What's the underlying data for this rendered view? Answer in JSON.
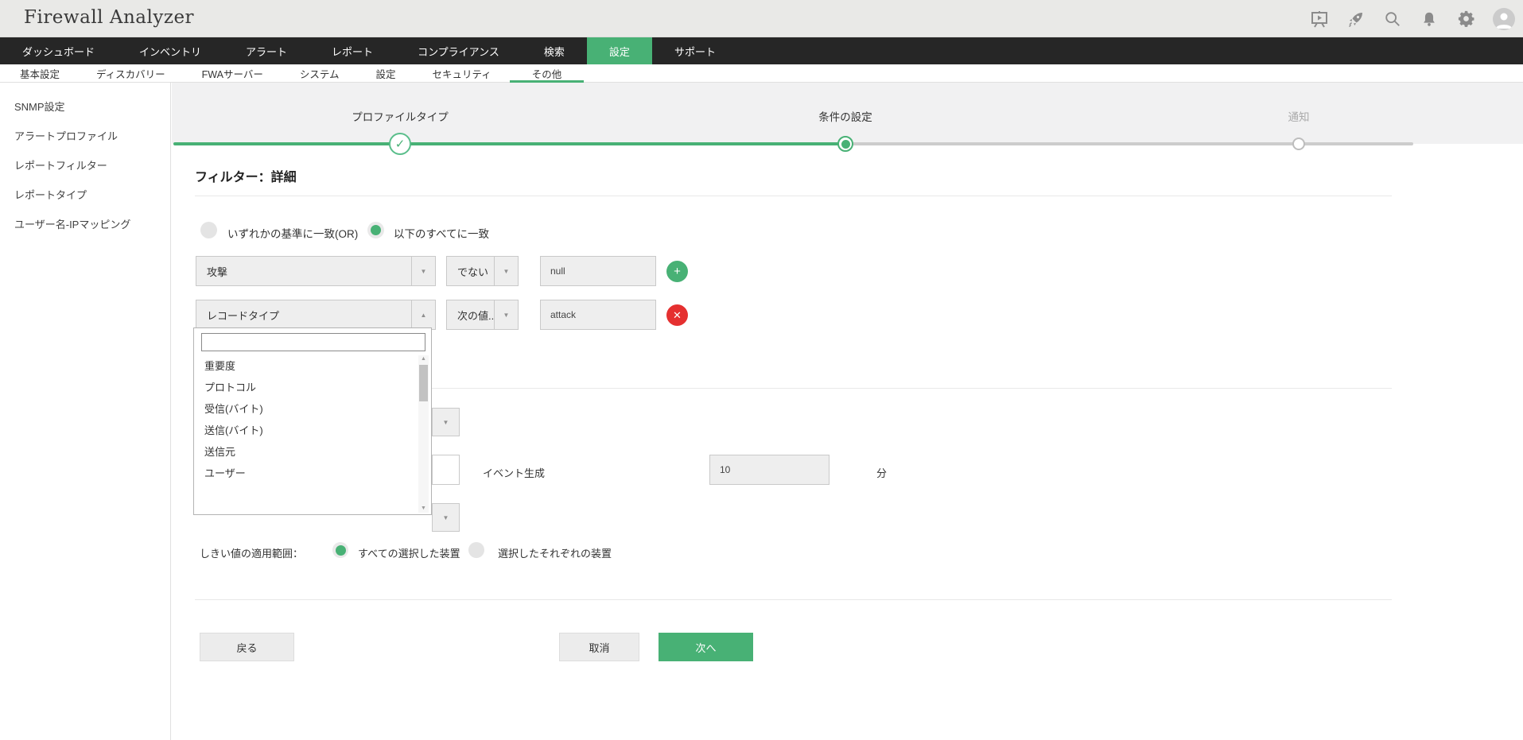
{
  "colors": {
    "accent": "#48b175",
    "red": "#e53030",
    "nav_bg": "#262626"
  },
  "header": {
    "title": "Firewall Analyzer",
    "icons": [
      "presentation-icon",
      "rocket-icon",
      "search-icon",
      "bell-icon",
      "gear-icon",
      "avatar"
    ]
  },
  "nav": {
    "items": [
      {
        "label": "ダッシュボード",
        "active": false
      },
      {
        "label": "インベントリ",
        "active": false
      },
      {
        "label": "アラート",
        "active": false
      },
      {
        "label": "レポート",
        "active": false
      },
      {
        "label": "コンプライアンス",
        "active": false
      },
      {
        "label": "検索",
        "active": false
      },
      {
        "label": "設定",
        "active": true
      },
      {
        "label": "サポート",
        "active": false
      }
    ]
  },
  "subnav": {
    "items": [
      {
        "label": "基本設定",
        "active": false
      },
      {
        "label": "ディスカバリー",
        "active": false
      },
      {
        "label": "FWAサーバー",
        "active": false
      },
      {
        "label": "システム",
        "active": false
      },
      {
        "label": "設定",
        "active": false
      },
      {
        "label": "セキュリティ",
        "active": false
      },
      {
        "label": "その他",
        "active": true
      }
    ]
  },
  "sidebar": {
    "items": [
      {
        "label": "SNMP設定"
      },
      {
        "label": "アラートプロファイル"
      },
      {
        "label": "レポートフィルター"
      },
      {
        "label": "レポートタイプ"
      },
      {
        "label": "ユーザー名-IPマッピング"
      }
    ]
  },
  "stepper": {
    "steps": [
      {
        "label": "プロファイルタイプ",
        "state": "done",
        "check": "✓"
      },
      {
        "label": "条件の設定",
        "state": "current"
      },
      {
        "label": "通知",
        "state": "upcoming"
      }
    ]
  },
  "main": {
    "heading": "フィルター：詳細",
    "match_radios": {
      "any_label": "いずれかの基準に一致(OR)",
      "all_label": "以下のすべてに一致",
      "selected": "all"
    },
    "filter_rows": [
      {
        "field": "攻撃",
        "operator": "でない",
        "value": "null",
        "action": "add"
      },
      {
        "field": "レコードタイプ",
        "operator": "次の値...",
        "value": "attack",
        "action": "remove"
      }
    ],
    "dropdown": {
      "search_value": "",
      "options": [
        {
          "label": "重要度"
        },
        {
          "label": "プロトコル"
        },
        {
          "label": "受信(バイト)"
        },
        {
          "label": "送信(バイト)"
        },
        {
          "label": "送信元"
        },
        {
          "label": "ユーザー"
        }
      ]
    },
    "event_row": {
      "label": "イベント生成",
      "value": "10",
      "unit": "分"
    },
    "threshold": {
      "label": "しきい値の適用範囲：",
      "option_all": "すべての選択した装置",
      "option_each": "選択したそれぞれの装置",
      "selected": "all"
    },
    "buttons": {
      "back": "戻る",
      "cancel": "取消",
      "next": "次へ"
    }
  }
}
